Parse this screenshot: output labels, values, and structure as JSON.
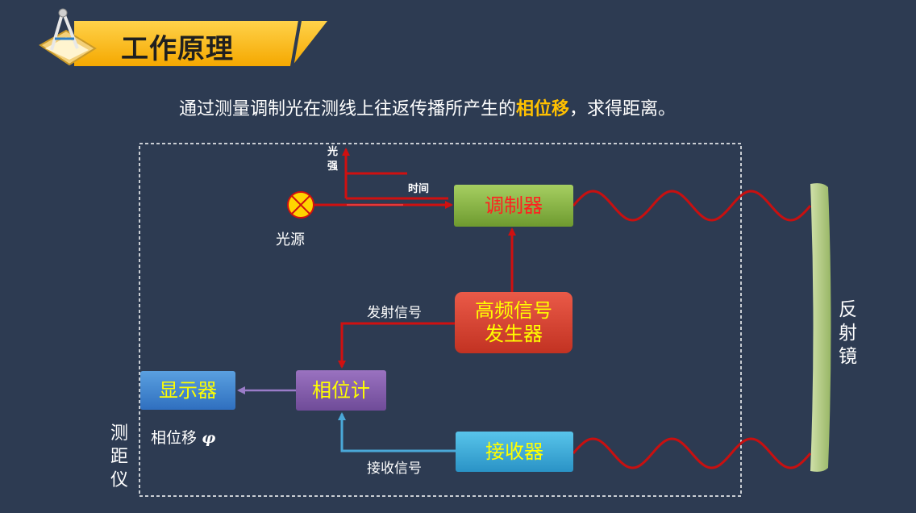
{
  "title": "工作原理",
  "subtitle": {
    "before": "通过测量调制光在测线上往返传播所产生的",
    "highlight": "相位移",
    "after": "，求得距离。"
  },
  "diagram": {
    "light_source_label": "光源",
    "intensity_axis_label": "光\n强",
    "time_axis_label": "时间",
    "modulator": "调制器",
    "hf_generator": "高频信号\n发生器",
    "transmit_signal": "发射信号",
    "phase_meter": "相位计",
    "display": "显示器",
    "phase_shift_label": "相位移",
    "phase_symbol": "φ",
    "receiver": "接收器",
    "receive_signal": "接收信号",
    "rangefinder_label": "测\n距\n仪",
    "reflector_label": "反\n射\n镜"
  },
  "colors": {
    "background": "#2d3b52",
    "banner": "#f5b400",
    "highlight": "#ffc000",
    "signal_red": "#d01010",
    "receive_blue": "#4aa8d8",
    "display_arrow": "#9a7cc8",
    "reflector": "#b9cf8e"
  }
}
